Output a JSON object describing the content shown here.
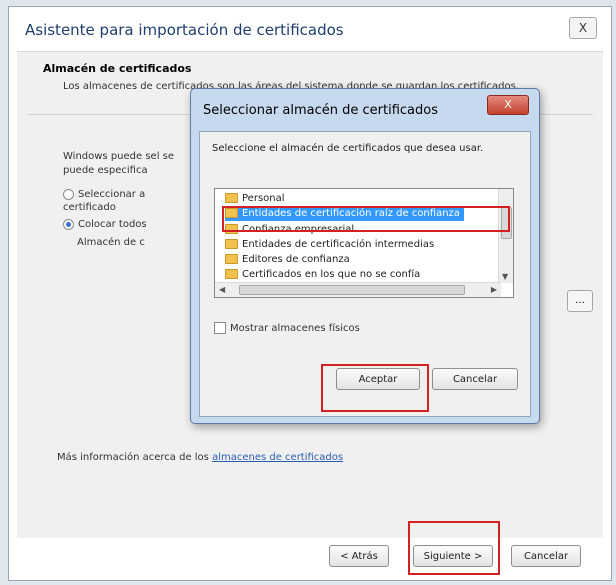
{
  "wizard": {
    "title": "Asistente para importación de certificados",
    "close_label": "X",
    "section_title": "Almacén de certificados",
    "section_desc": "Los almacenes de certificados son las áreas del sistema donde se guardan los certificados.",
    "windows_text": "Windows puede sel se puede especifica",
    "option1_label": "Seleccionar a certificado",
    "option2_label": "Colocar todos",
    "store_label": "Almacén de c",
    "more_info_prefix": "Más información acerca de los",
    "more_info_link": "almacenes de certificados",
    "browse_label": "...",
    "back_label": "< Atrás",
    "next_label": "Siguiente >",
    "cancel_label": "Cancelar"
  },
  "dialog": {
    "title": "Seleccionar almacén de certificados",
    "close_label": "X",
    "description": "Seleccione el almacén de certificados que desea usar.",
    "items": [
      "Personal",
      "Entidades de certificación raíz de confianza",
      "Confianza empresarial",
      "Entidades de certificación intermedias",
      "Editores de confianza",
      "Certificados en los que no se confía"
    ],
    "selected_index": 1,
    "show_physical_label": "Mostrar almacenes físicos",
    "accept_label": "Aceptar",
    "cancel_label": "Cancelar"
  },
  "colors": {
    "selection": "#3399ff",
    "highlight": "#d32020",
    "title_text": "#1f3f6e"
  }
}
